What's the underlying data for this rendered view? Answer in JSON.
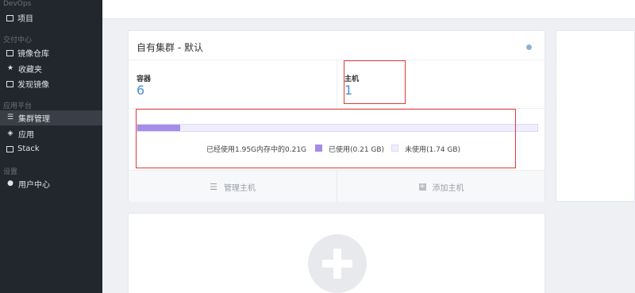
{
  "sidebar": {
    "sections": [
      {
        "title": "DevOps",
        "items": [
          {
            "label": "项目",
            "icon": "calendar-icon"
          }
        ]
      },
      {
        "title": "交付中心",
        "items": [
          {
            "label": "镜像仓库",
            "icon": "disk-icon"
          },
          {
            "label": "收藏夹",
            "icon": "star-icon"
          },
          {
            "label": "发现镜像",
            "icon": "window-icon"
          }
        ]
      },
      {
        "title": "应用平台",
        "items": [
          {
            "label": "集群管理",
            "icon": "server-icon",
            "active": true
          },
          {
            "label": "应用",
            "icon": "layers-icon"
          },
          {
            "label": "Stack",
            "icon": "stack-icon"
          }
        ]
      },
      {
        "title": "设置",
        "items": [
          {
            "label": "用户中心",
            "icon": "user-icon"
          }
        ]
      }
    ]
  },
  "cluster_card": {
    "title": "自有集群 - 默认",
    "status_color": "#8fb0dc",
    "containers": {
      "label": "容器",
      "value": "6"
    },
    "hosts": {
      "label": "主机",
      "value": "1"
    },
    "memory": {
      "used_fraction": 0.1077,
      "summary": "已经使用1.95G内存中的0.21G",
      "used_label": "已使用(0.21 GB)",
      "unused_label": "未使用(1.74 GB)",
      "used_color": "#a58ce8",
      "unused_color": "#efeefe"
    },
    "actions": {
      "manage_hosts": "管理主机",
      "add_host": "添加主机"
    }
  },
  "add_card": {
    "icon": "plus-icon"
  }
}
